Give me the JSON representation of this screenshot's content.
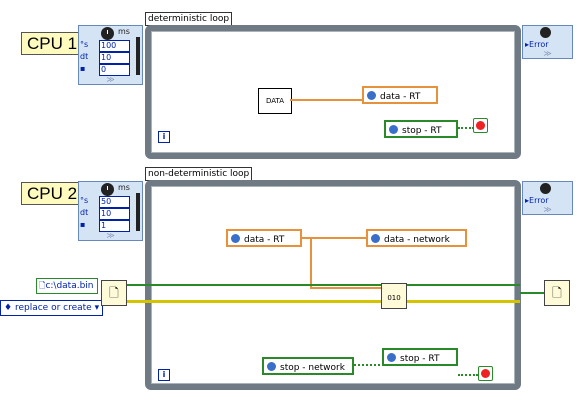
{
  "cpu1": {
    "label": "CPU 1"
  },
  "cpu2": {
    "label": "CPU 2"
  },
  "timed1": {
    "unit": "ms",
    "rows": [
      {
        "label": "°s",
        "value": "100"
      },
      {
        "label": "dt",
        "value": "10"
      },
      {
        "label": "▪",
        "value": "0"
      }
    ]
  },
  "timed2": {
    "unit": "ms",
    "rows": [
      {
        "label": "°s",
        "value": "50"
      },
      {
        "label": "dt",
        "value": "10"
      },
      {
        "label": "▪",
        "value": "1"
      }
    ]
  },
  "loop1": {
    "title": "deterministic loop",
    "iter": "i"
  },
  "loop2": {
    "title": "non-deterministic loop",
    "iter": "i"
  },
  "out1": {
    "label": "Error"
  },
  "out2": {
    "label": "Error"
  },
  "nodes": {
    "data_box": "DATA",
    "data_rt_1": "data - RT",
    "stop_rt_1": "stop - RT",
    "data_rt_2": "data - RT",
    "data_network": "data - network",
    "stop_network": "stop - network",
    "stop_rt_2": "stop - RT",
    "write_icon": "010"
  },
  "file_path": "c:\\data.bin",
  "open_mode": "replace or create",
  "colors": {
    "loop_frame": "#6f7a84",
    "shared_var_border": "#e6913c",
    "stop_border": "#2a8a2a",
    "error_wire": "#d4c400",
    "refnum_wire": "#2a8a2a",
    "timed_node_bg": "#d5e4f5",
    "cpu_label_bg": "#fffbbf"
  },
  "icons": [
    "clock-icon",
    "shared-variable-icon",
    "network-variable-icon",
    "stop-icon",
    "open-file-icon",
    "write-binary-icon",
    "close-file-icon"
  ]
}
